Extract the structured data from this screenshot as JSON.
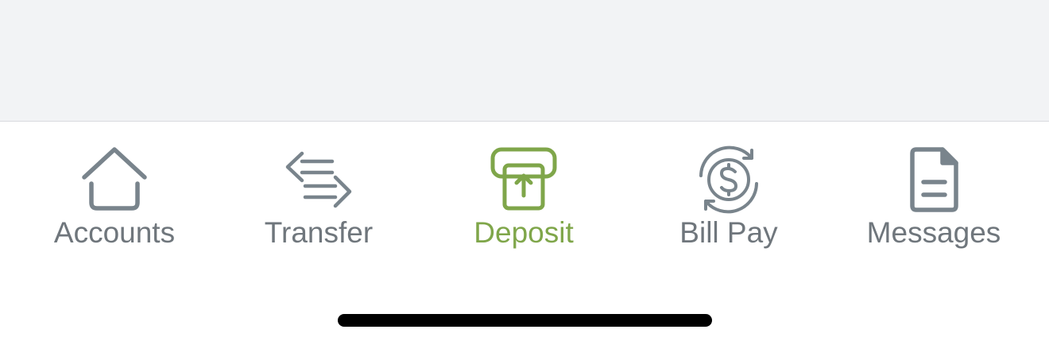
{
  "tabbar": {
    "tabs": [
      {
        "label": "Accounts",
        "icon": "house-icon",
        "active": false
      },
      {
        "label": "Transfer",
        "icon": "transfer-arrows-icon",
        "active": false
      },
      {
        "label": "Deposit",
        "icon": "deposit-check-icon",
        "active": true
      },
      {
        "label": "Bill Pay",
        "icon": "bill-pay-cycle-dollar-icon",
        "active": false
      },
      {
        "label": "Messages",
        "icon": "document-icon",
        "active": false
      }
    ]
  },
  "colors": {
    "inactive": "#6f767c",
    "active": "#7fa64a",
    "highlight": "#ffff7d",
    "content_background": "#f2f3f5"
  }
}
